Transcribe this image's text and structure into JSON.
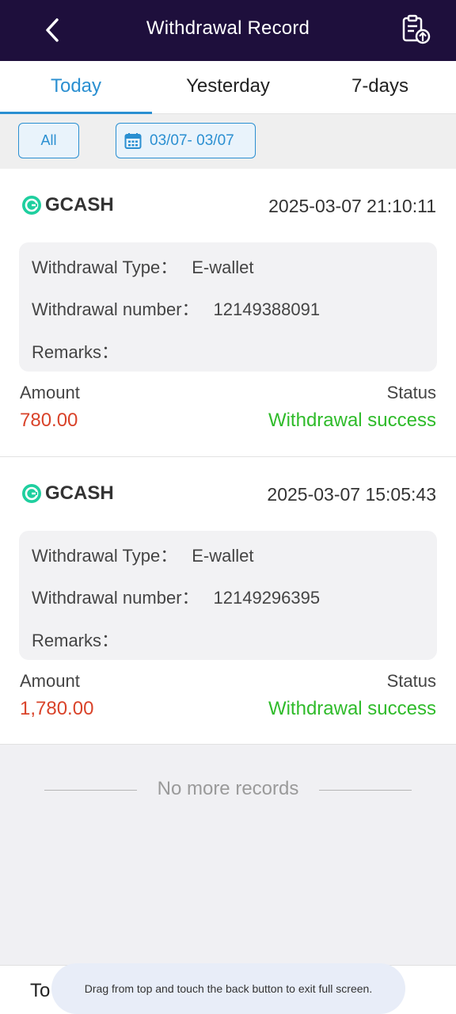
{
  "header": {
    "title": "Withdrawal Record"
  },
  "tabs": [
    {
      "label": "Today",
      "active": true
    },
    {
      "label": "Yesterday",
      "active": false
    },
    {
      "label": "7-days",
      "active": false
    }
  ],
  "filter": {
    "all_label": "All",
    "date_range": "03/07- 03/07"
  },
  "labels": {
    "type": "Withdrawal Type：",
    "number": "Withdrawal number：",
    "remarks": "Remarks：",
    "amount": "Amount",
    "status": "Status"
  },
  "records": [
    {
      "brand": "GCASH",
      "time": "2025-03-07 21:10:11",
      "type": "E-wallet",
      "number": "12149388091",
      "remarks": "",
      "amount": "780.00",
      "status": "Withdrawal success"
    },
    {
      "brand": "GCASH",
      "time": "2025-03-07 15:05:43",
      "type": "E-wallet",
      "number": "12149296395",
      "remarks": "",
      "amount": "1,780.00",
      "status": "Withdrawal success"
    }
  ],
  "footer_note": "No more records",
  "bottom_bar": {
    "label": "To"
  },
  "toast": "Drag from top and touch the back button to exit full screen.",
  "colors": {
    "header_bg": "#1e0f3c",
    "accent": "#2a8fd1",
    "amount": "#d9432a",
    "success": "#2fbb2a",
    "gcash": "#1fcf9f"
  }
}
